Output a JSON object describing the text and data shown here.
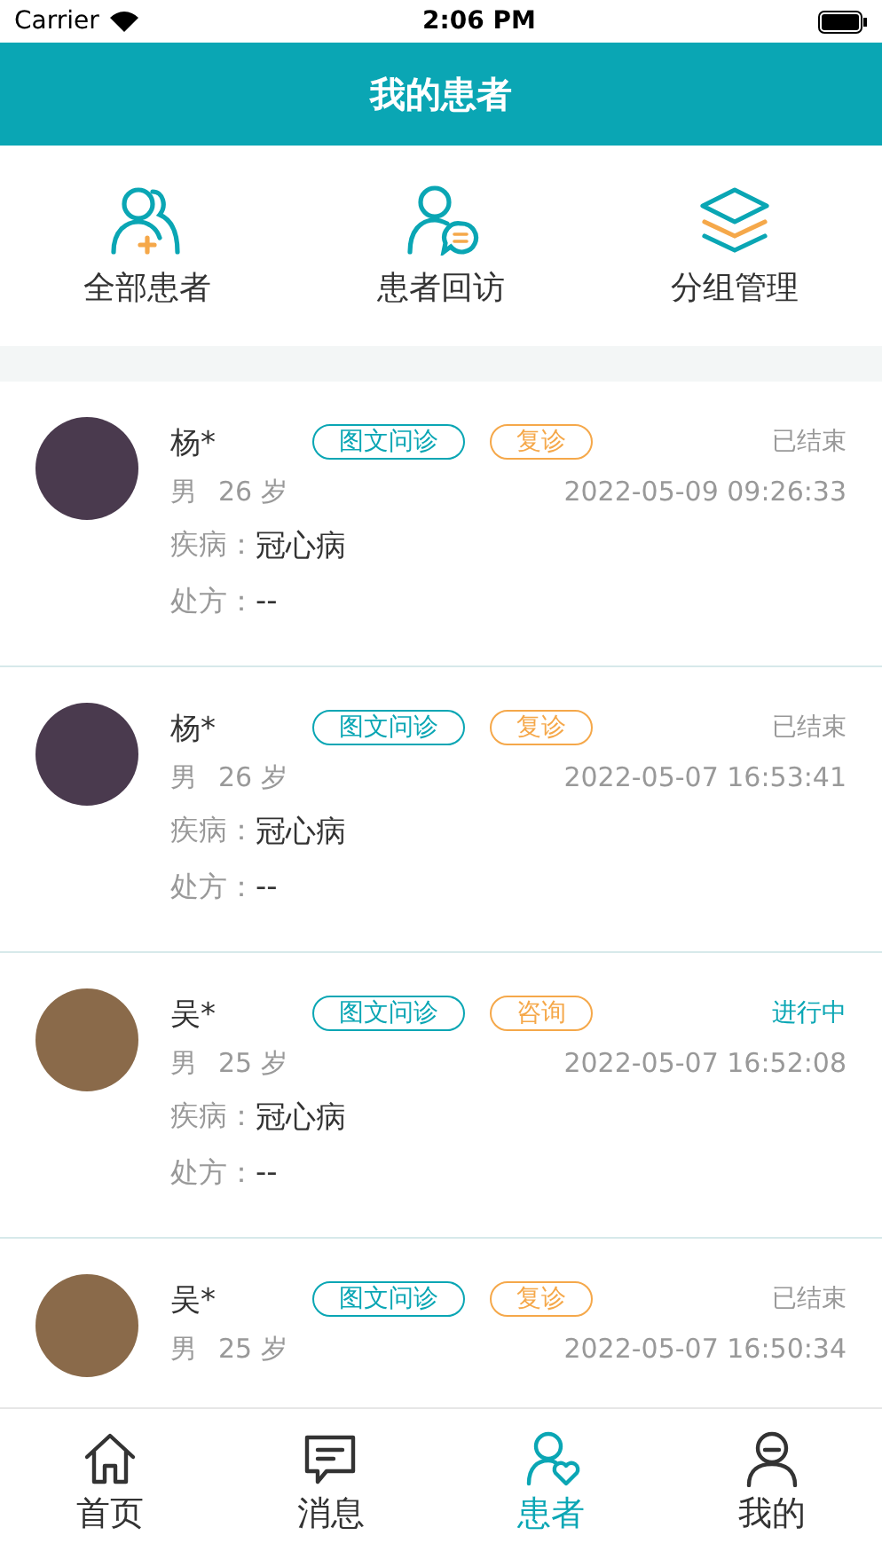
{
  "status_bar": {
    "carrier": "Carrier",
    "time": "2:06 PM"
  },
  "header": {
    "title": "我的患者"
  },
  "shortcuts": [
    {
      "kind": "all",
      "label": "全部患者"
    },
    {
      "kind": "followup",
      "label": "患者回访"
    },
    {
      "kind": "groups",
      "label": "分组管理"
    }
  ],
  "patients": [
    {
      "name": "杨*",
      "tags": [
        {
          "kind": "type",
          "label": "图文问诊"
        },
        {
          "kind": "visit",
          "label": "复诊"
        }
      ],
      "status": {
        "kind": "ended",
        "label": "已结束"
      },
      "gender": "男",
      "age": "26 岁",
      "time": "2022-05-09 09:26:33",
      "disease_label": "疾病：",
      "disease": "冠心病",
      "prescription_label": "处方：",
      "prescription": "--"
    },
    {
      "name": "杨*",
      "tags": [
        {
          "kind": "type",
          "label": "图文问诊"
        },
        {
          "kind": "visit",
          "label": "复诊"
        }
      ],
      "status": {
        "kind": "ended",
        "label": "已结束"
      },
      "gender": "男",
      "age": "26 岁",
      "time": "2022-05-07 16:53:41",
      "disease_label": "疾病：",
      "disease": "冠心病",
      "prescription_label": "处方：",
      "prescription": "--"
    },
    {
      "name": "吴*",
      "tags": [
        {
          "kind": "type",
          "label": "图文问诊"
        },
        {
          "kind": "visit",
          "label": "咨询"
        }
      ],
      "status": {
        "kind": "active",
        "label": "进行中"
      },
      "gender": "男",
      "age": "25 岁",
      "time": "2022-05-07 16:52:08",
      "disease_label": "疾病：",
      "disease": "冠心病",
      "prescription_label": "处方：",
      "prescription": "--"
    },
    {
      "name": "吴*",
      "tags": [
        {
          "kind": "type",
          "label": "图文问诊"
        },
        {
          "kind": "visit",
          "label": "复诊"
        }
      ],
      "status": {
        "kind": "ended",
        "label": "已结束"
      },
      "gender": "男",
      "age": "25 岁",
      "time": "2022-05-07 16:50:34"
    }
  ],
  "tab_bar": [
    {
      "kind": "home",
      "label": "首页",
      "selected": false
    },
    {
      "kind": "messages",
      "label": "消息",
      "selected": false
    },
    {
      "kind": "patients",
      "label": "患者",
      "selected": true
    },
    {
      "kind": "me",
      "label": "我的",
      "selected": false
    }
  ]
}
